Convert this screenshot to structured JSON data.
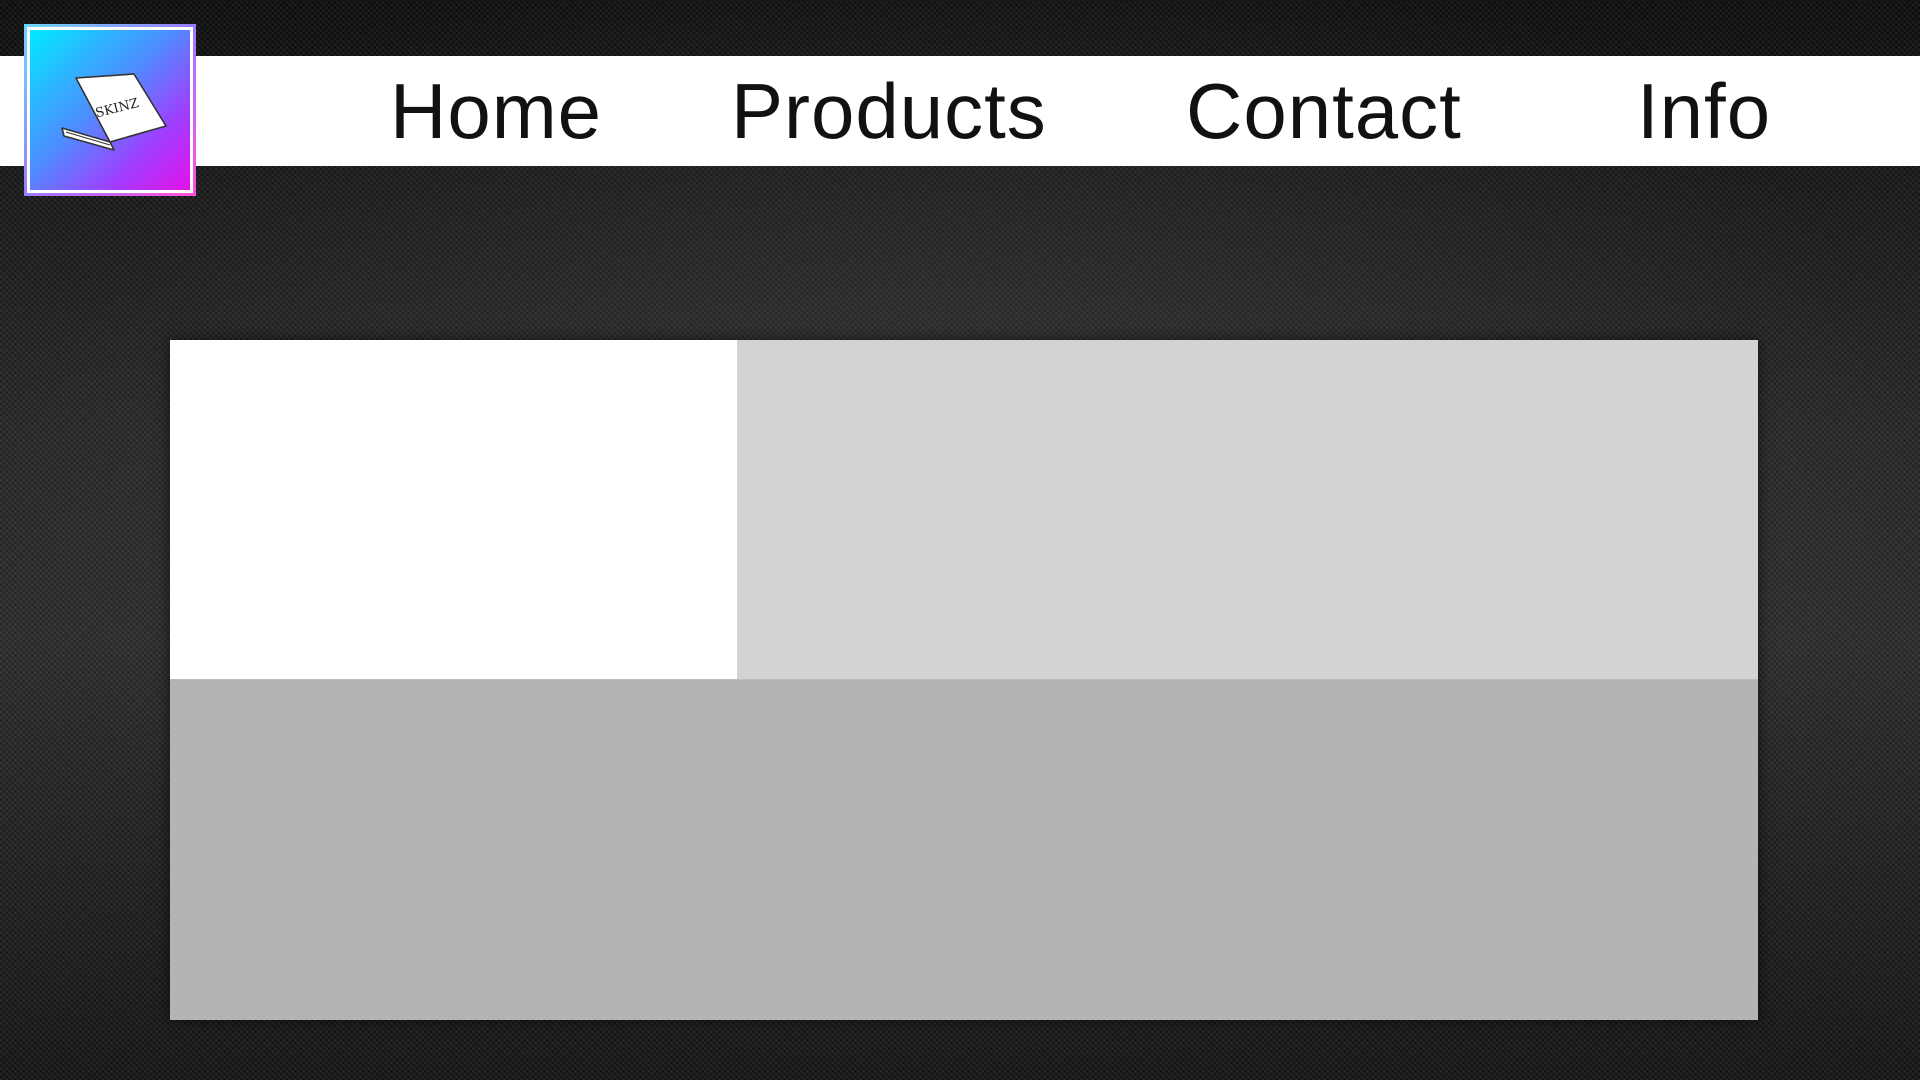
{
  "brand": {
    "logo_icon": "laptop-icon",
    "logo_text": "SKINZ",
    "gradient_colors": [
      "#00eaff",
      "#4f8cff",
      "#a23cff",
      "#e312e8"
    ]
  },
  "nav": {
    "items": [
      {
        "label": "Home"
      },
      {
        "label": "Products"
      },
      {
        "label": "Contact"
      },
      {
        "label": "Info"
      }
    ]
  },
  "colors": {
    "nav_background": "#ffffff",
    "nav_text": "#111111",
    "page_background": "#1c1c1c",
    "panel_top_left": "#ffffff",
    "panel_top_right": "#d3d3d3",
    "panel_bottom": "#b4b4b4"
  }
}
